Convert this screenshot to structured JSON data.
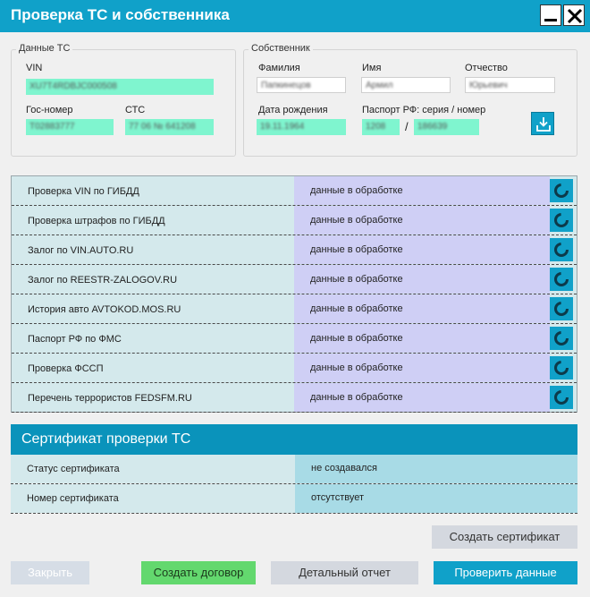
{
  "window": {
    "title": "Проверка ТС и собственника"
  },
  "vehicle": {
    "legend": "Данные ТС",
    "vin_label": "VIN",
    "vin_value": "XU7T4RDBJC000508",
    "reg_label": "Гос-номер",
    "reg_value": "Т02883777",
    "sts_label": "СТС",
    "sts_value": "77 06 № 641208"
  },
  "owner": {
    "legend": "Собственник",
    "surname_label": "Фамилия",
    "surname_value": "Папкинецов",
    "name_label": "Имя",
    "name_value": "Армил",
    "patronymic_label": "Отчество",
    "patronymic_value": "Юрьевич",
    "dob_label": "Дата рождения",
    "dob_value": "19.11.1964",
    "passport_label": "Паспорт РФ: серия / номер",
    "passport_series": "1208",
    "passport_slash": "/",
    "passport_number": "186639"
  },
  "checks": [
    {
      "name": "Проверка VIN по ГИБДД",
      "status": "данные в обработке"
    },
    {
      "name": "Проверка штрафов по ГИБДД",
      "status": "данные в обработке"
    },
    {
      "name": "Залог по VIN.AUTO.RU",
      "status": "данные в обработке"
    },
    {
      "name": "Залог по REESTR-ZALOGOV.RU",
      "status": "данные в обработке"
    },
    {
      "name": "История авто AVTOKOD.MOS.RU",
      "status": "данные в обработке"
    },
    {
      "name": "Паспорт РФ по ФМС",
      "status": "данные в обработке"
    },
    {
      "name": "Проверка ФССП",
      "status": "данные в обработке"
    },
    {
      "name": "Перечень террористов FEDSFM.RU",
      "status": "данные в обработке"
    }
  ],
  "certificate": {
    "title": "Сертификат проверки ТС",
    "rows": [
      {
        "name": "Статус сертификата",
        "value": "не создавался"
      },
      {
        "name": "Номер сертификата",
        "value": "отсутствует"
      }
    ],
    "create_button": "Создать сертификат"
  },
  "footer": {
    "close_button": "Закрыть",
    "contract_button": "Создать договор",
    "report_button": "Детальный отчет",
    "check_button": "Проверить данные"
  },
  "colors": {
    "accent": "#10a1c9",
    "field_green": "#7ff5cf",
    "status_purple": "#cfcff5",
    "name_cell": "#d4e9ec",
    "button_green": "#63d86e"
  },
  "icons": {
    "minimize": "minimize-icon",
    "close": "close-icon",
    "download": "download-icon",
    "spinner": "loading-spinner-icon"
  }
}
